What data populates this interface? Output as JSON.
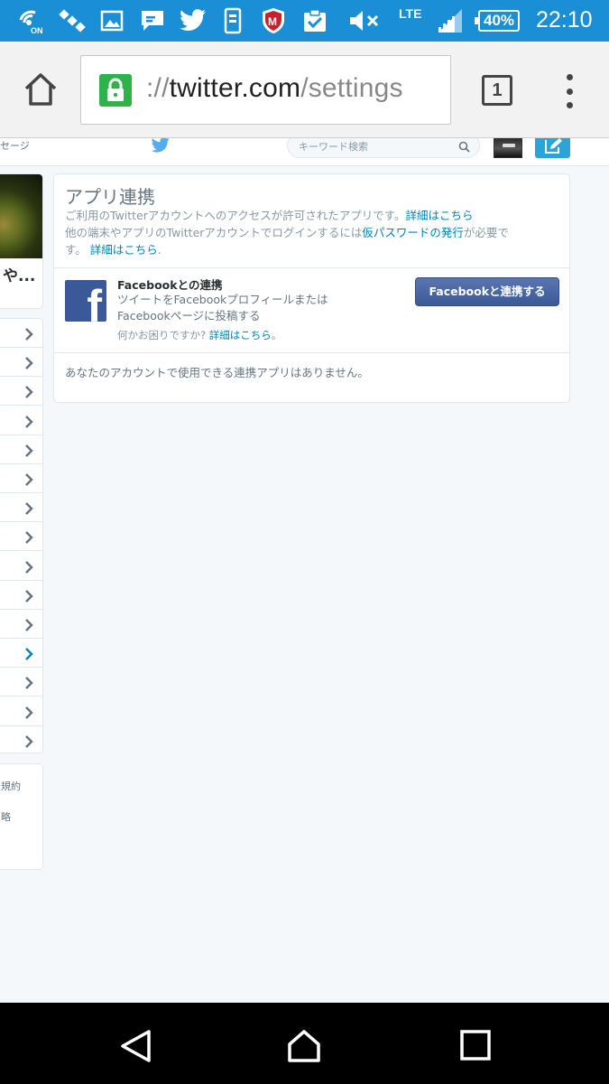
{
  "status_bar": {
    "network_type": "LTE",
    "battery": "40%",
    "time": "22:10",
    "icons": [
      "wifi-on-icon",
      "satellite-icon",
      "image-icon",
      "chat-icon",
      "twitter-bird-icon",
      "phone-app-icon",
      "mcafee-shield-icon",
      "clipboard-check-icon",
      "volume-muted-icon",
      "signal-icon"
    ]
  },
  "browser": {
    "url_scheme_fragment": "://",
    "url_host": "twitter.com",
    "url_path": "/settings",
    "tab_count": "1"
  },
  "twitter_header": {
    "messages_fragment": "セージ",
    "search_placeholder": "キーワード検索"
  },
  "sidebar": {
    "profile_name_fragment": "や...",
    "menu_item_count": 15,
    "active_menu_index": 11,
    "footer_links": [
      "規約",
      "略"
    ]
  },
  "apps": {
    "title": "アプリ連携",
    "desc_line1": "ご利用のTwitterアカウントへのアクセスが許可されたアプリです。",
    "desc_link1": "詳細はこちら",
    "desc_line2": "他の端末やアプリのTwitterアカウントでログインするには",
    "desc_link2": "仮パスワードの発行",
    "desc_line2_end": "が必要で",
    "desc_line3": "す。",
    "desc_link3": "詳細はこちら",
    "desc_line3_end": "."
  },
  "facebook": {
    "title": "Facebookとの連携",
    "desc_line1": "ツイートをFacebookプロフィールまたは",
    "desc_line2": "Facebookページに投稿する",
    "help_text": "何かお困りですか?",
    "help_link": "詳細はこちら",
    "help_end": "。",
    "button_label": "Facebookと連携する"
  },
  "no_apps_message": "あなたのアカウントで使用できる連携アプリはありません。",
  "colors": {
    "status_bar": "#1a8fd6",
    "facebook_blue": "#3b5998",
    "link": "#0084b4",
    "ssl_green": "#2fb24a"
  }
}
